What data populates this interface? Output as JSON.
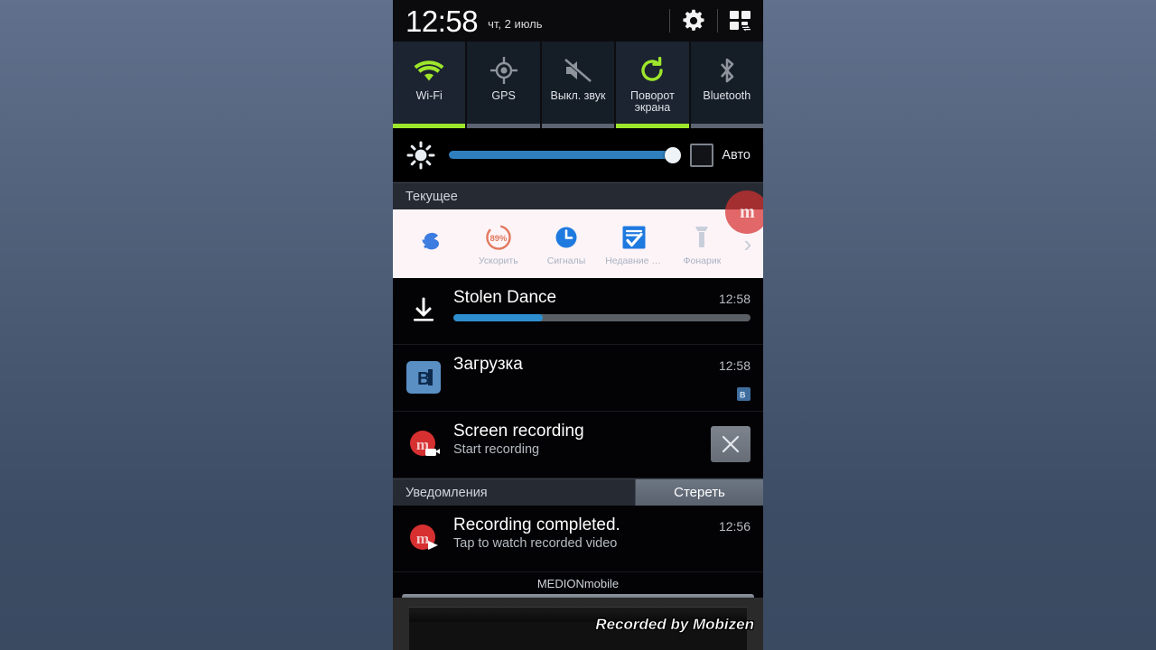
{
  "statusbar": {
    "time": "12:58",
    "date": "чт, 2 июль",
    "settings_icon": "gear-icon",
    "panel_icon": "quick-panel-grid-icon"
  },
  "quick_settings": [
    {
      "label": "Wi-Fi",
      "icon": "wifi-icon",
      "active": true
    },
    {
      "label": "GPS",
      "icon": "gps-crosshair-icon",
      "active": false
    },
    {
      "label": "Выкл. звук",
      "icon": "mute-icon",
      "active": false
    },
    {
      "label": "Поворот\nэкрана",
      "icon": "screen-rotate-icon",
      "active": true
    },
    {
      "label": "Bluetooth",
      "icon": "bluetooth-icon",
      "active": false
    }
  ],
  "brightness": {
    "icon": "brightness-sun-icon",
    "value": 97,
    "auto_label": "Авто",
    "auto_checked": false
  },
  "sections": {
    "ongoing_title": "Текущее",
    "notifications_title": "Уведомления",
    "clear_label": "Стереть"
  },
  "shortcuts": [
    {
      "label": "",
      "icon": "s-logo-icon",
      "badge": ""
    },
    {
      "label": "Ускорить",
      "icon": "boost-ring-icon",
      "badge": "89%"
    },
    {
      "label": "Сигналы",
      "icon": "alarm-clock-icon",
      "badge": ""
    },
    {
      "label": "Недавние п...",
      "icon": "checklist-icon",
      "badge": ""
    },
    {
      "label": "Фонарик",
      "icon": "flashlight-icon",
      "badge": ""
    }
  ],
  "shortcuts_more_icon": "chevron-right-icon",
  "ongoing_notifications": [
    {
      "title": "Stolen Dance",
      "time": "12:58",
      "icon": "download-arrow-icon",
      "progress": 30,
      "subtitle": ""
    },
    {
      "title": "Загрузка",
      "time": "12:58",
      "icon": "vk-app-icon",
      "subtitle": "",
      "small_icon": "vk-small-icon"
    },
    {
      "title": "Screen recording",
      "subtitle": "Start recording",
      "time": "",
      "icon": "mobizen-icon",
      "action_icon": "close-x-icon"
    }
  ],
  "notifications": [
    {
      "title": "Recording completed.",
      "subtitle": "Tap to watch recorded video",
      "time": "12:56",
      "icon": "mobizen-play-icon"
    }
  ],
  "carrier": "MEDIONmobile",
  "floating_bubble": {
    "icon": "mobizen-bubble-icon",
    "glyph": "m"
  },
  "watermark": "Recorded by Mobizen",
  "colors": {
    "accent_green": "#9ee62b",
    "accent_blue": "#2f7fbe",
    "mobizen_red": "#d63031",
    "panel_bg": "#030305"
  }
}
